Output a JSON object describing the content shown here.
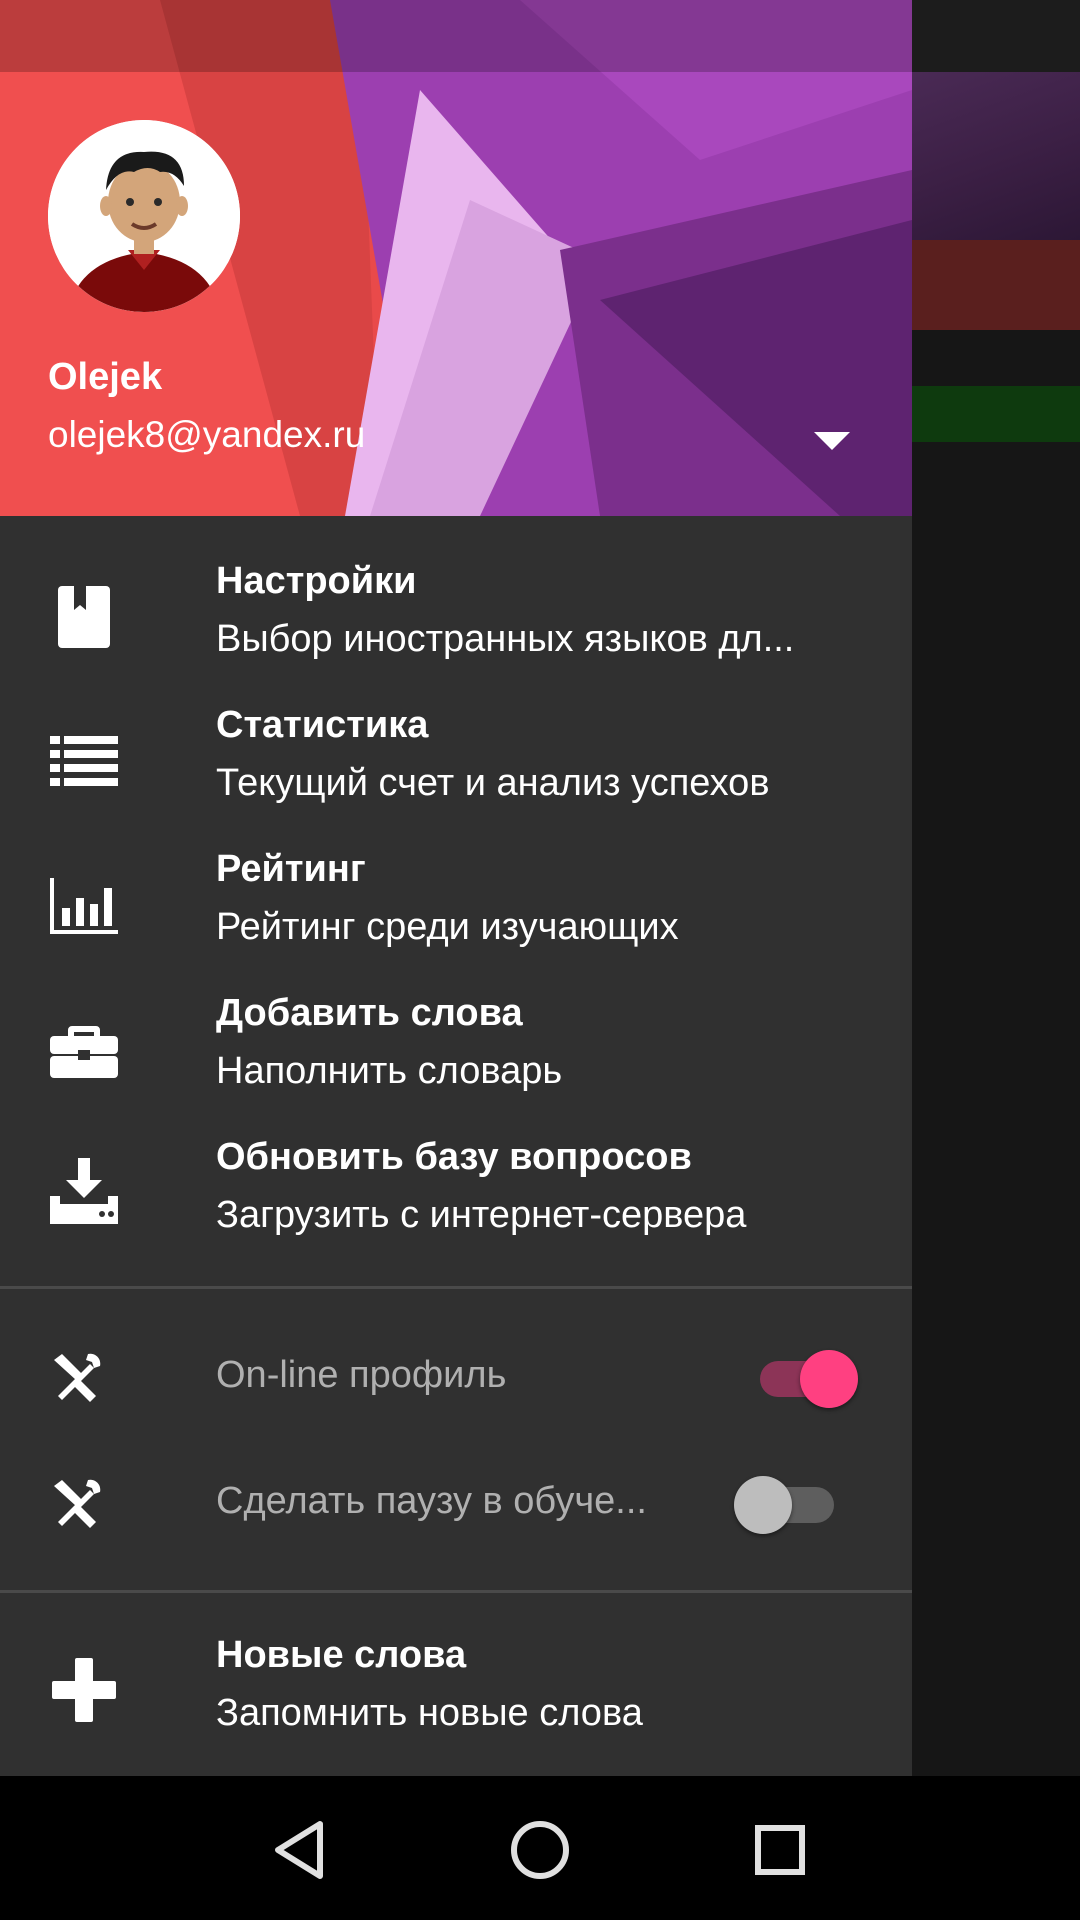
{
  "account": {
    "name": "Olejek",
    "email": "olejek8@yandex.ru"
  },
  "menu": [
    {
      "title": "Настройки",
      "subtitle": "Выбор иностранных языков дл...",
      "icon": "book-icon"
    },
    {
      "title": "Статистика",
      "subtitle": "Текущий счет и анализ успехов",
      "icon": "list-icon"
    },
    {
      "title": "Рейтинг",
      "subtitle": "Рейтинг среди изучающих",
      "icon": "bar-chart-icon"
    },
    {
      "title": "Добавить слова",
      "subtitle": "Наполнить словарь",
      "icon": "briefcase-icon"
    },
    {
      "title": "Обновить базу вопросов",
      "subtitle": "Загрузить с интернет-сервера",
      "icon": "download-icon"
    }
  ],
  "switches": [
    {
      "label": "On-line профиль",
      "checked": true,
      "icon": "tools-icon"
    },
    {
      "label": "Сделать паузу в обуче...",
      "checked": false,
      "icon": "tools-icon"
    }
  ],
  "bottom_item": {
    "title": "Новые слова",
    "subtitle": "Запомнить новые слова",
    "icon": "plus-icon"
  },
  "navbar": {
    "back": "back-icon",
    "home": "home-icon",
    "recents": "recents-icon"
  },
  "colors": {
    "drawer_bg": "#303030",
    "accent": "#ff4081",
    "header_red": "#e84848",
    "header_purple": "#9c3fb0"
  }
}
